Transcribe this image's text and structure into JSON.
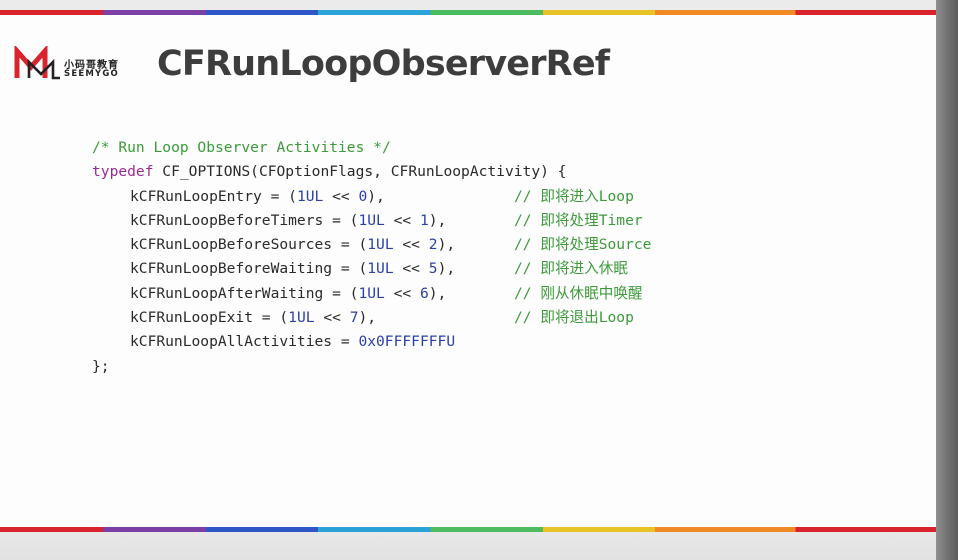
{
  "slide": {
    "logo": {
      "cn": "小码哥教育",
      "en": "SEEMYGO"
    },
    "title": "CFRunLoopObserverRef"
  },
  "colors": {
    "rainbow": [
      "#d9232d",
      "#7b3fa6",
      "#2f56c6",
      "#2aa3d8",
      "#4dbb5f",
      "#e8c326",
      "#ef8a24",
      "#d9232d"
    ],
    "comment": "#3d9a3b",
    "keyword": "#9b2a8f",
    "number": "#2c3fa6",
    "title": "#3d3d3d"
  },
  "code": {
    "header_comment": "/* Run Loop Observer Activities */",
    "decl_keyword": "typedef",
    "decl_rest": " CF_OPTIONS(CFOptionFlags, CFRunLoopActivity) {",
    "entries": [
      {
        "name": "kCFRunLoopEntry",
        "shift": "0",
        "comment": "// 即将进入Loop"
      },
      {
        "name": "kCFRunLoopBeforeTimers",
        "shift": "1",
        "comment": "// 即将处理Timer"
      },
      {
        "name": "kCFRunLoopBeforeSources",
        "shift": "2",
        "comment": "// 即将处理Source"
      },
      {
        "name": "kCFRunLoopBeforeWaiting",
        "shift": "5",
        "comment": "// 即将进入休眠"
      },
      {
        "name": "kCFRunLoopAfterWaiting",
        "shift": "6",
        "comment": "// 刚从休眠中唤醒"
      },
      {
        "name": "kCFRunLoopExit",
        "shift": "7",
        "comment": "// 即将退出Loop"
      }
    ],
    "all_activities": {
      "name": "kCFRunLoopAllActivities",
      "value": "0x0FFFFFFFU"
    },
    "closing": "};"
  }
}
